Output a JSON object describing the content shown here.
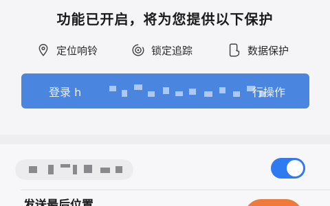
{
  "header": {
    "title": "功能已开启，将为您提供以下保护"
  },
  "features": [
    {
      "label": "定位响铃",
      "icon": "location-pin-icon"
    },
    {
      "label": "锁定追踪",
      "icon": "lock-tracking-icon"
    },
    {
      "label": "数据保护",
      "icon": "phone-data-protect-icon"
    }
  ],
  "login_button": {
    "prefix": "登录 h",
    "suffix": "行操作"
  },
  "settings_row": {
    "toggle_state": "on"
  },
  "next_row": {
    "label": "发送最后位置"
  },
  "colors": {
    "primary": "#4a86e0",
    "toggle_on": "#2f7af0",
    "accent": "#f07a3a"
  }
}
